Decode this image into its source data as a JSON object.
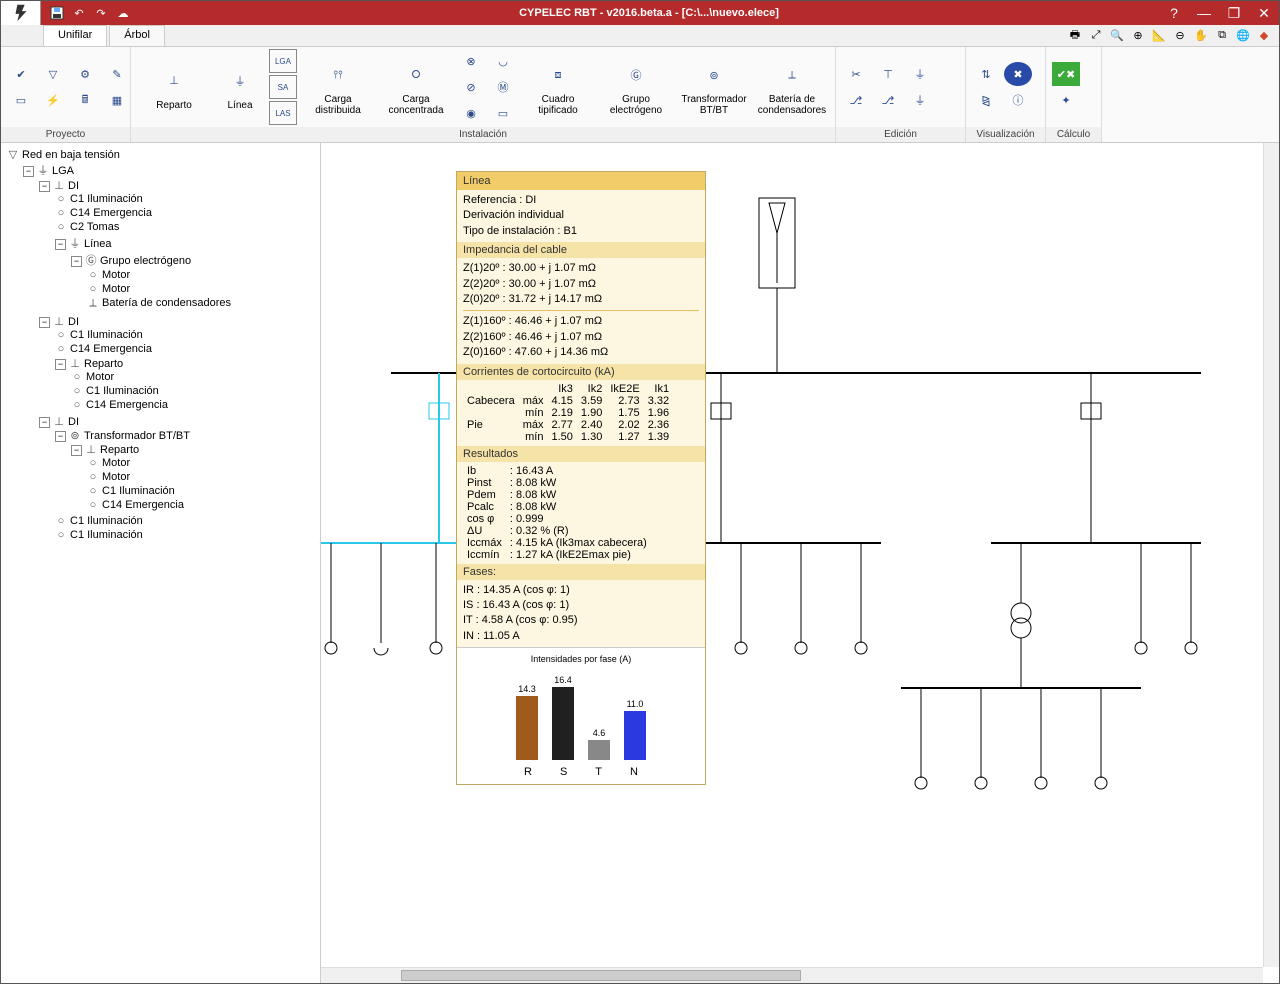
{
  "title": "CYPELEC RBT - v2016.beta.a - [C:\\...\\nuevo.elece]",
  "tabs": {
    "t1": "Unifilar",
    "t2": "Árbol"
  },
  "ribbon": {
    "proyecto": "Proyecto",
    "instalacion": "Instalación",
    "edicion": "Edición",
    "visualizacion": "Visualización",
    "calculo": "Cálculo",
    "reparto": "Reparto",
    "linea": "Línea",
    "carga_dist": "Carga distribuida",
    "carga_conc": "Carga concentrada",
    "cuadro": "Cuadro tipificado",
    "grupo": "Grupo electrógeno",
    "transf": "Transformador BT/BT",
    "bateria": "Batería de condensadores"
  },
  "tree": {
    "root": "Red en baja tensión",
    "lga": "LGA",
    "di": "DI",
    "c1_ilum": "C1 Iluminación",
    "c14_emer": "C14 Emergencia",
    "c2_tomas": "C2 Tomas",
    "linea": "Línea",
    "grupo_elec": "Grupo electrógeno",
    "motor": "Motor",
    "bateria_cond": "Batería de condensadores",
    "reparto": "Reparto",
    "transf_bt": "Transformador BT/BT"
  },
  "panel": {
    "titulo": "Línea",
    "referencia": "Referencia : DI",
    "derivacion": "Derivación individual",
    "tipo_inst": "Tipo de instalación : B1",
    "impedancia_hdr": "Impedancia del cable",
    "z1_20": "Z(1)20º : 30.00 + j 1.07 mΩ",
    "z2_20": "Z(2)20º : 30.00 + j 1.07 mΩ",
    "z0_20": "Z(0)20º : 31.72 + j 14.17 mΩ",
    "z1_160": "Z(1)160º : 46.46 + j 1.07 mΩ",
    "z2_160": "Z(2)160º : 46.46 + j 1.07 mΩ",
    "z0_160": "Z(0)160º : 47.60 + j 14.36 mΩ",
    "corrientes_hdr": "Corrientes de cortocircuito (kA)",
    "cc_hdr_k3": "Ik3",
    "cc_hdr_k2": "Ik2",
    "cc_hdr_e2e": "IkE2E",
    "cc_hdr_k1": "Ik1",
    "cabecera": "Cabecera",
    "pie": "Pie",
    "max": "máx",
    "min": "mín",
    "cab_max": [
      "4.15",
      "3.59",
      "2.73",
      "3.32"
    ],
    "cab_min": [
      "2.19",
      "1.90",
      "1.75",
      "1.96"
    ],
    "pie_max": [
      "2.77",
      "2.40",
      "2.02",
      "2.36"
    ],
    "pie_min": [
      "1.50",
      "1.30",
      "1.27",
      "1.39"
    ],
    "resultados_hdr": "Resultados",
    "ib": "Ib",
    "ib_v": ": 16.43 A",
    "pinst": "Pinst",
    "pinst_v": ": 8.08 kW",
    "pdem": "Pdem",
    "pdem_v": ": 8.08 kW",
    "pcalc": "Pcalc",
    "pcalc_v": ": 8.08 kW",
    "cos": "cos φ",
    "cos_v": ": 0.999",
    "du": "ΔU",
    "du_v": ": 0.32 % (R)",
    "iccmax": "Iccmáx",
    "iccmax_v": ": 4.15 kA (Ik3max cabecera)",
    "iccmin": "Iccmín",
    "iccmin_v": ": 1.27 kA (IkE2Emax pie)",
    "fases_hdr": "Fases:",
    "ir": "IR : 14.35 A (cos φ: 1)",
    "is": "IS : 16.43 A (cos φ: 1)",
    "it": "IT : 4.58 A (cos φ: 0.95)",
    "in": "IN : 11.05 A",
    "chart_title": "Intensidades por fase (A)"
  },
  "chart_data": {
    "type": "bar",
    "categories": [
      "R",
      "S",
      "T",
      "N"
    ],
    "values": [
      14.3,
      16.4,
      4.6,
      11.0
    ],
    "title": "Intensidades por fase (A)",
    "colors": [
      "#a05a1a",
      "#202020",
      "#888888",
      "#2a3ae0"
    ],
    "xlabel": "",
    "ylabel": "",
    "ylim": [
      0,
      18
    ]
  }
}
